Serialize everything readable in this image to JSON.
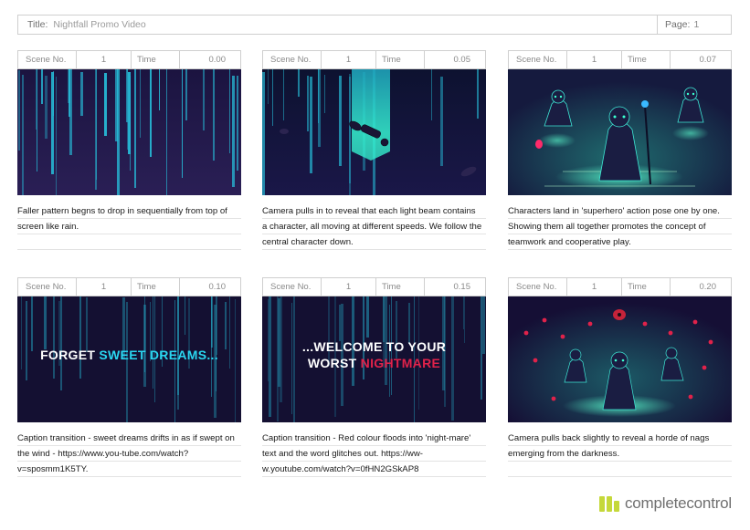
{
  "header": {
    "title_label": "Title:",
    "title_value": "Nightfall Promo Video",
    "page_label": "Page:",
    "page_value": "1"
  },
  "panels": [
    {
      "scene_label": "Scene No.",
      "scene_value": "1",
      "time_label": "Time",
      "time_value": "0.00",
      "description": "Faller pattern begns to drop in sequentially from top of screen like rain."
    },
    {
      "scene_label": "Scene No.",
      "scene_value": "1",
      "time_label": "Time",
      "time_value": "0.05",
      "description": "Camera pulls in to reveal that each light beam contains a character, all moving at different speeds. We follow the central character down."
    },
    {
      "scene_label": "Scene No.",
      "scene_value": "1",
      "time_label": "Time",
      "time_value": "0.07",
      "description": "Characters land in 'superhero' action pose one by one. Showing them all together promotes the concept of teamwork and cooperative play."
    },
    {
      "scene_label": "Scene No.",
      "scene_value": "1",
      "time_label": "Time",
      "time_value": "0.10",
      "description": "Caption transition - sweet dreams drifts in as if swept on the wind - https://www.you-tube.com/watch?v=sposmm1K5TY.",
      "caption_a": "FORGET ",
      "caption_b": "SWEET DREAMS..."
    },
    {
      "scene_label": "Scene No.",
      "scene_value": "1",
      "time_label": "Time",
      "time_value": "0.15",
      "description": "Caption transition - Red colour floods into 'night-mare' text and the word glitches out. https://ww-w.youtube.com/watch?v=0fHN2GSkAP8",
      "caption_line1": "...WELCOME TO YOUR",
      "caption_line2a": "WORST ",
      "caption_line2b": "NIGHTMARE"
    },
    {
      "scene_label": "Scene No.",
      "scene_value": "1",
      "time_label": "Time",
      "time_value": "0.20",
      "description": "Camera pulls back slightly to reveal a horde of nags emerging from the darkness."
    }
  ],
  "footer": {
    "logo_text": "completecontrol"
  },
  "colors": {
    "beam": "#27c4df",
    "background": "#141032",
    "glow": "#35f2c4",
    "accent_red": "#e0224a",
    "logo_green": "#c5d83a"
  }
}
